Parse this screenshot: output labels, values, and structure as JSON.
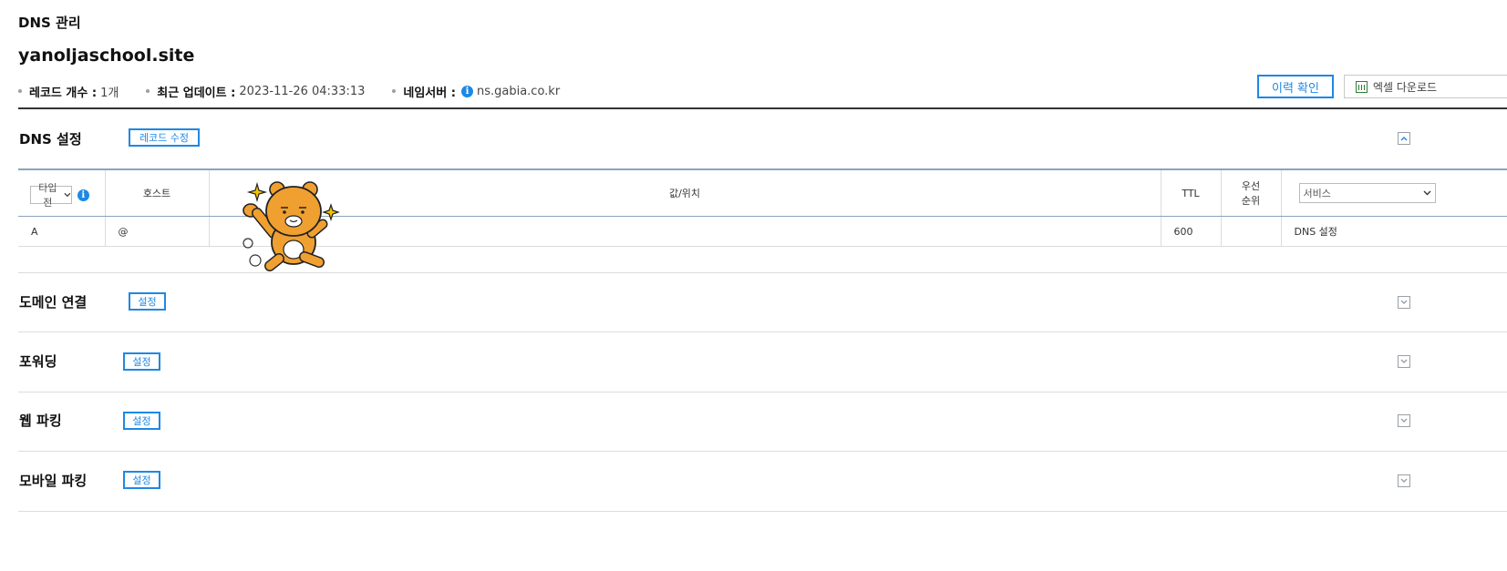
{
  "page": {
    "label": "DNS 관리",
    "domain": "yanoljaschool.site"
  },
  "meta": {
    "record_count_label": "레코드 개수 :",
    "record_count_value": "1개",
    "updated_label": "최근 업데이트 :",
    "updated_value": "2023-11-26 04:33:13",
    "nameserver_label": "네임서버 :",
    "nameserver_value": "ns.gabia.co.kr"
  },
  "actions": {
    "history": "이력 확인",
    "excel": "엑셀 다운로드"
  },
  "dns_section": {
    "title": "DNS 설정",
    "edit_button": "레코드 수정",
    "headers": {
      "type_select": "타입 전",
      "host": "호스트",
      "value": "값/위치",
      "ttl": "TTL",
      "priority_line1": "우선",
      "priority_line2": "순위",
      "service_select": "서비스"
    },
    "rows": [
      {
        "type": "A",
        "host": "@",
        "value": "",
        "ttl": "600",
        "priority": "",
        "service": "DNS 설정"
      }
    ]
  },
  "sections": [
    {
      "title": "도메인 연결",
      "button": "설정"
    },
    {
      "title": "포워딩",
      "button": "설정"
    },
    {
      "title": "웹 파킹",
      "button": "설정"
    },
    {
      "title": "모바일 파킹",
      "button": "설정"
    }
  ],
  "colors": {
    "accent": "#1e88e5",
    "sticker": "#f0a030"
  },
  "icons": {
    "info": "info-icon",
    "excel": "excel-icon",
    "collapse": "chevron-up-icon",
    "expand": "chevron-down-icon",
    "sticker": "bear-sticker"
  }
}
